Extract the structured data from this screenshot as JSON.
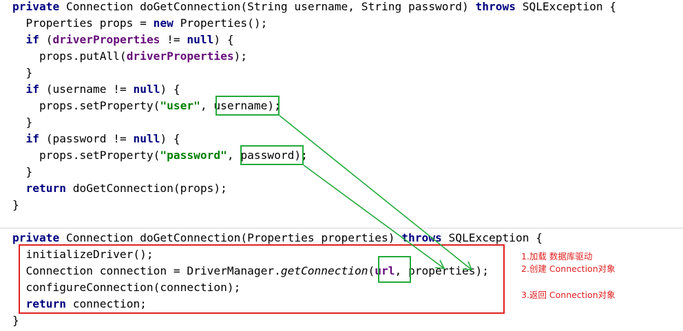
{
  "code_block_1": [
    [
      {
        "t": "private",
        "c": "kw"
      },
      {
        "t": " Connection doGetConnection(String username, String password) "
      },
      {
        "t": "throws",
        "c": "kw"
      },
      {
        "t": " SQLException {"
      }
    ],
    [
      {
        "t": "  Properties props = "
      },
      {
        "t": "new",
        "c": "kw"
      },
      {
        "t": " Properties();"
      }
    ],
    [
      {
        "t": "  "
      },
      {
        "t": "if",
        "c": "kw"
      },
      {
        "t": " ("
      },
      {
        "t": "driverProperties",
        "c": "field"
      },
      {
        "t": " != "
      },
      {
        "t": "null",
        "c": "kw"
      },
      {
        "t": ") {"
      }
    ],
    [
      {
        "t": "    props.putAll("
      },
      {
        "t": "driverProperties",
        "c": "field"
      },
      {
        "t": ");"
      }
    ],
    [
      {
        "t": "  }"
      }
    ],
    [
      {
        "t": "  "
      },
      {
        "t": "if",
        "c": "kw"
      },
      {
        "t": " (username != "
      },
      {
        "t": "null",
        "c": "kw"
      },
      {
        "t": ") {"
      }
    ],
    [
      {
        "t": "    props.setProperty("
      },
      {
        "t": "\"user\"",
        "c": "str"
      },
      {
        "t": ", username);"
      }
    ],
    [
      {
        "t": "  }"
      }
    ],
    [
      {
        "t": "  "
      },
      {
        "t": "if",
        "c": "kw"
      },
      {
        "t": " (password != "
      },
      {
        "t": "null",
        "c": "kw"
      },
      {
        "t": ") {"
      }
    ],
    [
      {
        "t": "    props.setProperty("
      },
      {
        "t": "\"password\"",
        "c": "str"
      },
      {
        "t": ", password);"
      }
    ],
    [
      {
        "t": "  }"
      }
    ],
    [
      {
        "t": "  "
      },
      {
        "t": "return",
        "c": "kw"
      },
      {
        "t": " doGetConnection(props);"
      }
    ],
    [
      {
        "t": "}"
      }
    ]
  ],
  "code_block_2": [
    [
      {
        "t": "private",
        "c": "kw"
      },
      {
        "t": " Connection doGetConnection(Properties properties) "
      },
      {
        "t": "throws",
        "c": "kw"
      },
      {
        "t": " SQLException {"
      }
    ],
    [
      {
        "t": "  initializeDriver();"
      }
    ],
    [
      {
        "t": "  Connection connection = DriverManager."
      },
      {
        "t": "getConnection",
        "c": "it"
      },
      {
        "t": "("
      },
      {
        "t": "url",
        "c": "field"
      },
      {
        "t": ", properties);"
      }
    ],
    [
      {
        "t": "  configureConnection(connection);"
      }
    ],
    [
      {
        "t": "  "
      },
      {
        "t": "return",
        "c": "kw"
      },
      {
        "t": " connection;"
      }
    ],
    [
      {
        "t": "}"
      }
    ]
  ],
  "annotations": {
    "step1": "1.加载 数据库驱动",
    "step2": "2.创建 Connection对象",
    "step3": "3.返回 Connection对象"
  },
  "colors": {
    "keyword": "#000080",
    "field": "#660e7a",
    "string": "#008000",
    "highlight_green": "#22aa3a",
    "highlight_red": "#e02020"
  }
}
